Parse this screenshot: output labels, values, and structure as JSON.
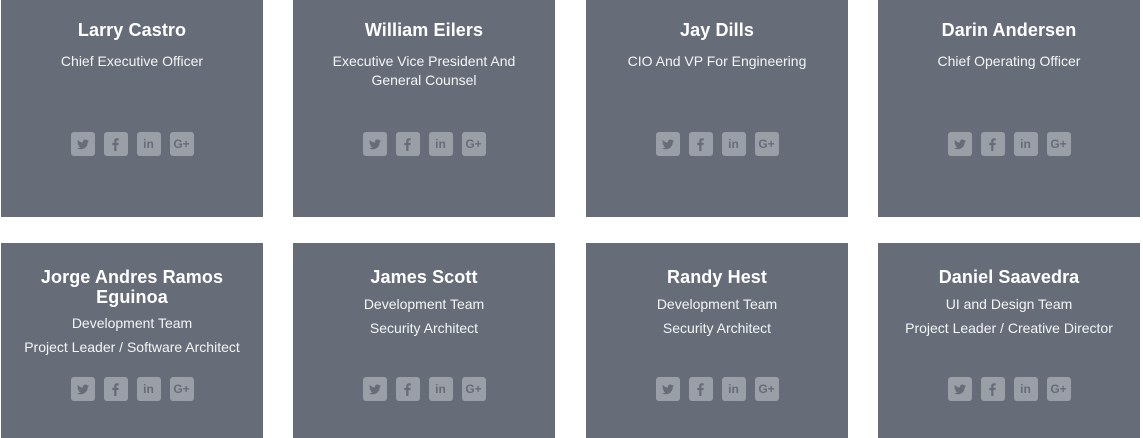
{
  "colors": {
    "card_background": "#676d78",
    "social_background": "#9a9ea7",
    "text": "#ffffff"
  },
  "social_icons": [
    "twitter-icon",
    "facebook-icon",
    "linkedin-icon",
    "google-plus-icon"
  ],
  "team": [
    {
      "name": "Larry Castro",
      "roles": [
        "Chief Executive Officer"
      ]
    },
    {
      "name": "William Eilers",
      "roles": [
        "Executive Vice President And General Counsel"
      ]
    },
    {
      "name": "Jay Dills",
      "roles": [
        "CIO And VP For Engineering"
      ]
    },
    {
      "name": "Darin Andersen",
      "roles": [
        "Chief Operating Officer"
      ]
    },
    {
      "name": "Jorge Andres Ramos Eguinoa",
      "roles": [
        "Development Team",
        "Project Leader / Software Architect"
      ]
    },
    {
      "name": "James Scott",
      "roles": [
        "Development Team",
        "Security Architect"
      ]
    },
    {
      "name": "Randy Hest",
      "roles": [
        "Development Team",
        "Security Architect"
      ]
    },
    {
      "name": "Daniel Saavedra",
      "roles": [
        "UI and Design Team",
        "Project Leader / Creative Director"
      ]
    }
  ]
}
